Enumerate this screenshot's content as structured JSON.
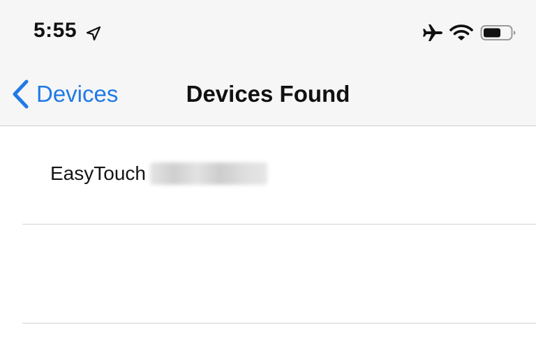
{
  "status_bar": {
    "time": "5:55",
    "icons": [
      "location-arrow-icon",
      "airplane-icon",
      "wifi-icon",
      "battery-icon"
    ]
  },
  "nav": {
    "back_label": "Devices",
    "title": "Devices Found"
  },
  "devices": [
    {
      "name": "EasyTouch",
      "suffix_redacted": true
    }
  ],
  "colors": {
    "accent": "#1f7ae6",
    "nav_background": "#f6f6f6",
    "separator": "#d3d3d3"
  }
}
